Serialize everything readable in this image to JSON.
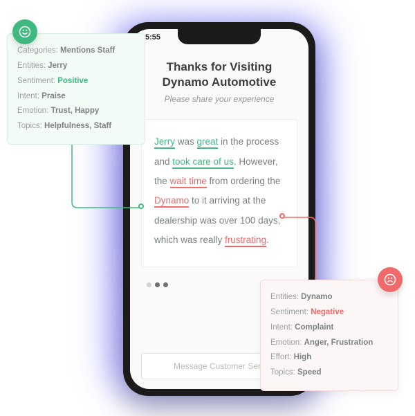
{
  "phone": {
    "time": "5:55",
    "title_line1": "Thanks for Visiting",
    "title_line2": "Dynamo Automotive",
    "subtitle": "Please share your experience",
    "review": {
      "s1a": "Jerry",
      "s1b": " was ",
      "s1c": "great",
      "s1d": " in the process and ",
      "s1e": "took care of us",
      "s1f": ". However, the ",
      "s1g": "wait time",
      "s1h": " from ordering the ",
      "s1i": "Dynamo",
      "s1j": " to it arriving at the dealership was over 100 days, which was really ",
      "s1k": "frustrating",
      "s1l": "."
    },
    "cta": "Message Customer Serv"
  },
  "positive": {
    "categories_k": "Categories:",
    "categories_v": "Mentions Staff",
    "entities_k": "Entities:",
    "entities_v": "Jerry",
    "sentiment_k": "Sentiment:",
    "sentiment_v": "Positive",
    "intent_k": "Intent:",
    "intent_v": "Praise",
    "emotion_k": "Emotion:",
    "emotion_v": "Trust, Happy",
    "topics_k": "Topics:",
    "topics_v": "Helpfulness, Staff"
  },
  "negative": {
    "entities_k": "Entities:",
    "entities_v": "Dynamo",
    "sentiment_k": "Sentiment:",
    "sentiment_v": "Negative",
    "intent_k": "Intent:",
    "intent_v": "Complaint",
    "emotion_k": "Emotion:",
    "emotion_v": "Anger, Frustration",
    "effort_k": "Effort:",
    "effort_v": "High",
    "topics_k": "Topics:",
    "topics_v": "Speed"
  }
}
